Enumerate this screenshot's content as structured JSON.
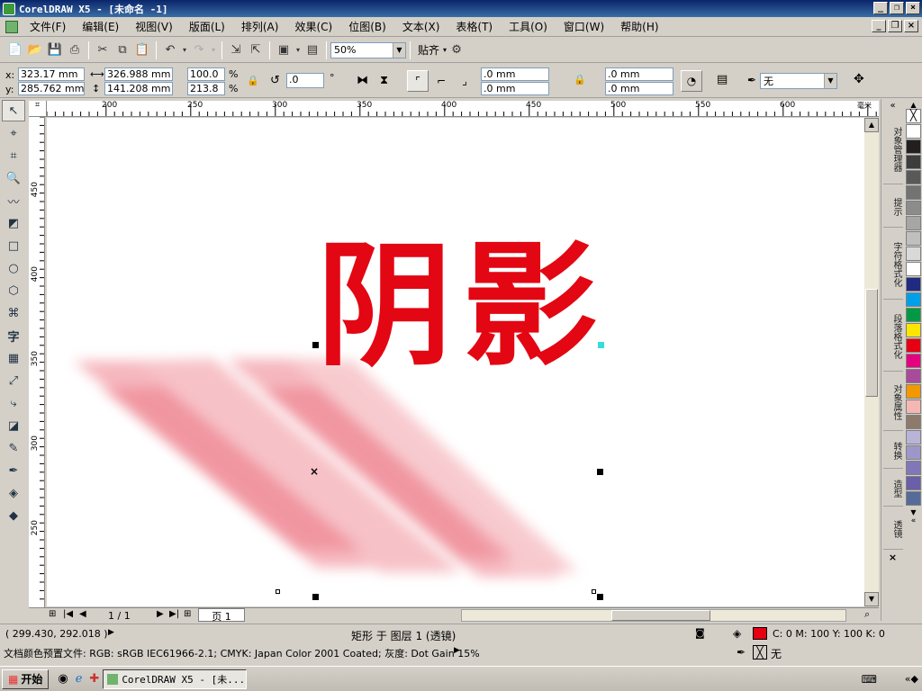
{
  "window": {
    "title": "CorelDRAW X5 - [未命名 -1]"
  },
  "menu": [
    "文件(F)",
    "编辑(E)",
    "视图(V)",
    "版面(L)",
    "排列(A)",
    "效果(C)",
    "位图(B)",
    "文本(X)",
    "表格(T)",
    "工具(O)",
    "窗口(W)",
    "帮助(H)"
  ],
  "toolbar": {
    "zoom": "50%",
    "snap_label": "贴齐"
  },
  "props": {
    "x_label": "x:",
    "x": "323.17 mm",
    "y_label": "y:",
    "y": "285.762 mm",
    "w": "326.988 mm",
    "h": "141.208 mm",
    "scale_w": "100.0",
    "scale_h": "213.8",
    "pct": "%",
    "rotate": ".0",
    "deg": "°",
    "corner1": ".0 mm",
    "corner2": ".0 mm",
    "corner3": ".0 mm",
    "corner4": ".0 mm",
    "outline": "无"
  },
  "ruler_h": [
    "200",
    "250",
    "300",
    "350",
    "400",
    "450",
    "500",
    "550",
    "600"
  ],
  "ruler_h_unit": "毫米",
  "ruler_v": [
    "450",
    "400",
    "350",
    "300",
    "250"
  ],
  "artwork": {
    "text": "阴影",
    "color": "#e30613",
    "shadow_color": "#f08a94"
  },
  "page_nav": {
    "current": "1 / 1",
    "tab": "页 1"
  },
  "dockers": [
    "对象管理器",
    "提示",
    "字符格式化",
    "段落格式化",
    "对象属性",
    "转换",
    "造型",
    "透镜"
  ],
  "palette": [
    "#ffffff",
    "#231f20",
    "#3d3d3d",
    "#595959",
    "#737373",
    "#8c8c8c",
    "#a6a6a6",
    "#bfbfbf",
    "#d9d9d9",
    "#ffffff",
    "#1f2a80",
    "#00a0e9",
    "#009944",
    "#ffe600",
    "#e60012",
    "#e4007f",
    "#a84b9b",
    "#f39800",
    "#f5b7b1",
    "#8c7a6b",
    "#b8b4d8",
    "#9d97c9",
    "#7f77b8",
    "#6a5fa8",
    "#556b9a"
  ],
  "status": {
    "coords": "( 299.430, 292.018 )",
    "object": "矩形 于 图层 1 (透镜)",
    "fill": "C: 0 M: 100 Y: 100 K: 0",
    "fill_color": "#e60012",
    "profile": "文档颜色预置文件: RGB: sRGB IEC61966-2.1; CMYK: Japan Color 2001 Coated; 灰度: Dot Gain 15%",
    "outline": "无"
  },
  "taskbar": {
    "start": "开始",
    "task": "CorelDRAW X5 - [未..."
  }
}
